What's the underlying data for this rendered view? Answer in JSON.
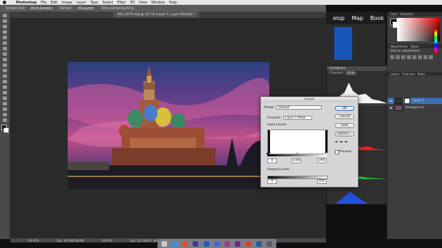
{
  "menubar": {
    "app_name": "Photoshop",
    "items": [
      "File",
      "Edit",
      "Image",
      "Layer",
      "Type",
      "Select",
      "Filter",
      "3D",
      "View",
      "Window",
      "Help"
    ]
  },
  "options_bar": {
    "sample_size_label": "Sample Size:",
    "sample_size_value": "Point Sample",
    "sample_label": "Sample:",
    "sample_value": "All Layers",
    "show_ring_label": "Show Sampling Ring"
  },
  "document_tab": {
    "title": "IMG_0379.dng @ 16.7% (Layer 1, Layer Mask/8) *"
  },
  "status_bar": {
    "zoom": "16.67%",
    "doc_info": "Doc: 48.7M/138.6M",
    "zoom_2": "16.67%",
    "doc_info_2": "Doc: 56.1M/201.3M"
  },
  "browser_panel": {
    "nav_items": [
      "elop",
      "Map",
      "Book"
    ]
  },
  "right_panel": {
    "color_tabs": [
      "Color",
      "Swatches"
    ],
    "adjust_tabs": [
      "Adjustments",
      "Styles"
    ],
    "add_adjustment": "Add an adjustment",
    "layers_tabs": [
      "Layers",
      "Channels",
      "Paths"
    ],
    "layers": [
      {
        "name": "Layer 1"
      },
      {
        "name": "Background"
      }
    ],
    "accent_color": "#e60000"
  },
  "histogram_panel": {
    "title": "Histogram",
    "channel_label": "Channel:",
    "channel_value": "RGB"
  },
  "levels_dialog": {
    "title": "Levels",
    "preset_label": "Preset:",
    "preset_value": "Default",
    "channel_label": "Channel:",
    "channel_value": "Layer 1 Mask",
    "input_levels_label": "Input Levels:",
    "input_black": "0",
    "input_gamma": "1.00",
    "input_white": "255",
    "output_levels_label": "Output Levels:",
    "output_black": "0",
    "output_white": "255",
    "ok_label": "OK",
    "cancel_label": "Cancel",
    "auto_label": "Auto",
    "options_label": "Options...",
    "preview_label": "Preview"
  }
}
